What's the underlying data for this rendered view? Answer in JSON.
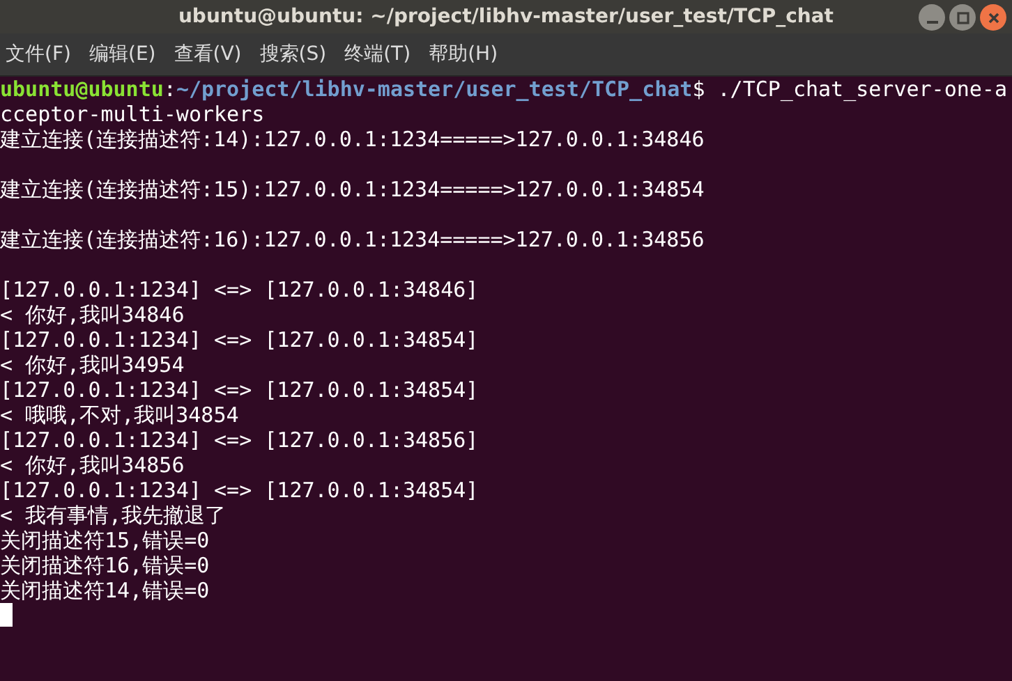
{
  "window": {
    "title": "ubuntu@ubuntu: ~/project/libhv-master/user_test/TCP_chat"
  },
  "menu": [
    "文件(F)",
    "编辑(E)",
    "查看(V)",
    "搜索(S)",
    "终端(T)",
    "帮助(H)"
  ],
  "terminal": {
    "lines": [
      {
        "kind": "prompt",
        "user": "ubuntu@ubuntu",
        "sep": ":",
        "path": "~/project/libhv-master/user_test/TCP_chat",
        "dollar": "$",
        "command": "./TCP_chat_server-one-a"
      },
      {
        "kind": "output",
        "text": "cceptor-multi-workers"
      },
      {
        "kind": "output",
        "text": "建立连接(连接描述符:14):127.0.0.1:1234=====>127.0.0.1:34846"
      },
      {
        "kind": "blank"
      },
      {
        "kind": "output",
        "text": "建立连接(连接描述符:15):127.0.0.1:1234=====>127.0.0.1:34854"
      },
      {
        "kind": "blank"
      },
      {
        "kind": "output",
        "text": "建立连接(连接描述符:16):127.0.0.1:1234=====>127.0.0.1:34856"
      },
      {
        "kind": "blank"
      },
      {
        "kind": "output",
        "text": "[127.0.0.1:1234] <=> [127.0.0.1:34846]"
      },
      {
        "kind": "output",
        "text": "< 你好,我叫34846"
      },
      {
        "kind": "output",
        "text": "[127.0.0.1:1234] <=> [127.0.0.1:34854]"
      },
      {
        "kind": "output",
        "text": "< 你好,我叫34954"
      },
      {
        "kind": "output",
        "text": "[127.0.0.1:1234] <=> [127.0.0.1:34854]"
      },
      {
        "kind": "output",
        "text": "< 哦哦,不对,我叫34854"
      },
      {
        "kind": "output",
        "text": "[127.0.0.1:1234] <=> [127.0.0.1:34856]"
      },
      {
        "kind": "output",
        "text": "< 你好,我叫34856"
      },
      {
        "kind": "output",
        "text": "[127.0.0.1:1234] <=> [127.0.0.1:34854]"
      },
      {
        "kind": "output",
        "text": "< 我有事情,我先撤退了"
      },
      {
        "kind": "output",
        "text": "关闭描述符15,错误=0"
      },
      {
        "kind": "output",
        "text": "关闭描述符16,错误=0"
      },
      {
        "kind": "output",
        "text": "关闭描述符14,错误=0"
      },
      {
        "kind": "cursor"
      }
    ]
  }
}
